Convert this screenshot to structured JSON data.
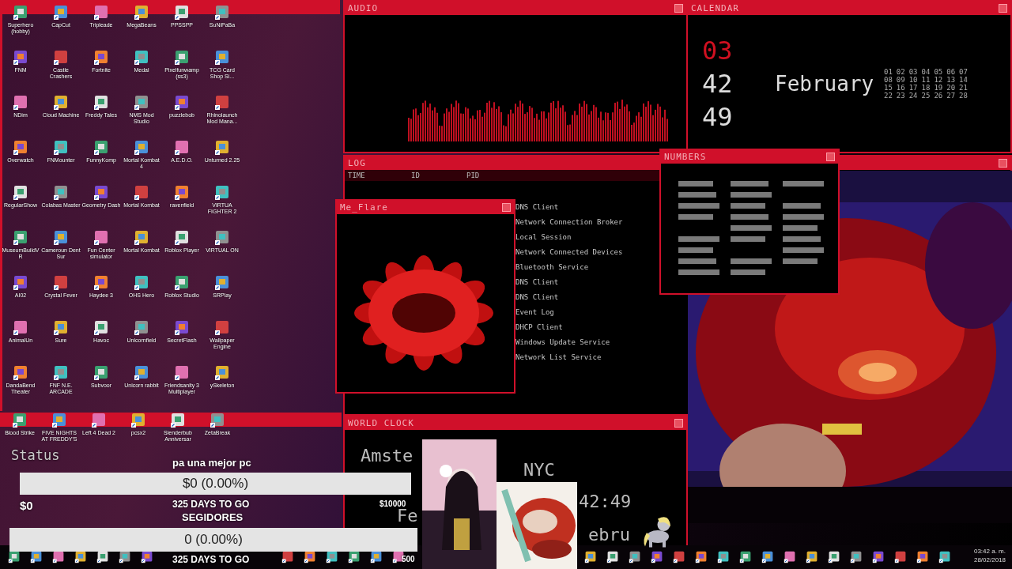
{
  "desktop": {
    "icons": [
      "Superhero (hobby)",
      "CapCut",
      "Tripleade",
      "MegaBeans",
      "PPSSPP",
      "SuNiPaBa",
      "FNM",
      "Castle Crashers",
      "Fortnite",
      "Medal",
      "Pixelfunwamp (ss3)",
      "TCG Card Shop Si...",
      "NDim",
      "Cloud Machine",
      "Freddy Tales",
      "NMS Mod Studio",
      "puzzlebob",
      "Rhinolaunch Mod Mana...",
      "Overwatch",
      "FNMounter",
      "FunnyKomp",
      "Mortal Kombat 4",
      "A.E.D.O.",
      "Unturned 2.25",
      "RegularShow",
      "Colabas Master",
      "Geometry Dash",
      "Mortal Kombat",
      "ravenfield",
      "VIRTUA FIGHTER 2",
      "MuseumBuildVR",
      "Cameroun Dent Sur",
      "Fun Center simulator",
      "Mortal Kombat",
      "Roblox Player",
      "VIRTUAL ON",
      "AI02",
      "Crystal Fever",
      "Haydee 3",
      "OHS Hero",
      "Roblox Studio",
      "SRPlay",
      "AnimalUn",
      "Sure",
      "Havoc",
      "Unicornfield",
      "SecretFlash",
      "Wallpaper Engine",
      "DandaBend Theater",
      "FNF N.E. ARCADE",
      "Subvoor",
      "Unicorn rabbit",
      "Friendsanity 3 Multiplayer",
      "ySkeleton"
    ]
  },
  "audio": {
    "title": "AUDIO"
  },
  "calendar": {
    "title": "CALENDAR",
    "hour": "03",
    "minute": "42",
    "second": "49",
    "month": "February",
    "weeks": [
      [
        "01",
        "02",
        "03",
        "04",
        "05",
        "06",
        "07"
      ],
      [
        "08",
        "09",
        "10",
        "11",
        "12",
        "13",
        "14"
      ],
      [
        "15",
        "16",
        "17",
        "18",
        "19",
        "20",
        "21"
      ],
      [
        "22",
        "23",
        "24",
        "25",
        "26",
        "27",
        "28"
      ]
    ]
  },
  "log": {
    "title": "LOG",
    "columns": [
      "TIME",
      "ID",
      "PID"
    ],
    "entries": [
      "DNS Client",
      "Network Connection Broker",
      "Local Session",
      "Network Connected Devices",
      "Bluetooth Service",
      "DNS Client",
      "DNS Client",
      "Event Log",
      "DHCP Client",
      "Windows Update Service",
      "Network List Service"
    ]
  },
  "numbers": {
    "title": "NUMBERS"
  },
  "flare": {
    "title": "Me_Flare"
  },
  "launcher": {
    "icons": [
      "Blood Strike",
      "FIVE NIGHTS AT FREDDY'S",
      "Left 4 Dead 2",
      "pcsx2",
      "Slenderbub Anniversar",
      "ZetaBreak"
    ]
  },
  "world_clock": {
    "title": "WORLD CLOCK",
    "cities": [
      "Amste",
      "NYC"
    ],
    "time": "42:49",
    "date_parts": [
      "Fe",
      "ebru"
    ]
  },
  "stream_overlay": {
    "status": "Status",
    "goals": [
      {
        "title": "pa una mejor pc",
        "amount": "$0",
        "bar_text": "$0 (0.00%)",
        "level": 0,
        "target": "$10000",
        "days_left": "325 DAYS TO GO"
      },
      {
        "title": "SEGIDORES",
        "bar_text": "0 (0.00%)",
        "level": 0,
        "target": "500",
        "days_left": "325 DAYS TO GO"
      }
    ]
  },
  "taskbar": {
    "time": "03:42 a. m.",
    "date": "28/02/2018"
  }
}
